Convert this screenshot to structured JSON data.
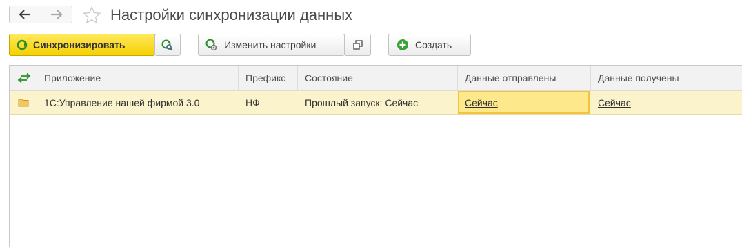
{
  "window": {
    "title": "Настройки синхронизации данных"
  },
  "nav": {
    "back": "back-arrow",
    "forward": "forward-arrow",
    "favorite": "star-icon"
  },
  "toolbar": {
    "sync_label": "Синхронизировать",
    "edit_settings_label": "Изменить настройки",
    "create_label": "Создать"
  },
  "table": {
    "columns": [
      "",
      "Приложение",
      "Префикс",
      "Состояние",
      "Данные отправлены",
      "Данные получены"
    ],
    "rows": [
      {
        "app": "1С:Управление нашей фирмой 3.0",
        "prefix": "НФ",
        "state": "Прошлый запуск: Сейчас",
        "sent": "Сейчас",
        "received": "Сейчас"
      }
    ]
  },
  "colors": {
    "accent_yellow": "#f5d000",
    "row_highlight": "#fbf3cc",
    "selected_cell": "#fde98b",
    "green_icon": "#3aa335"
  }
}
